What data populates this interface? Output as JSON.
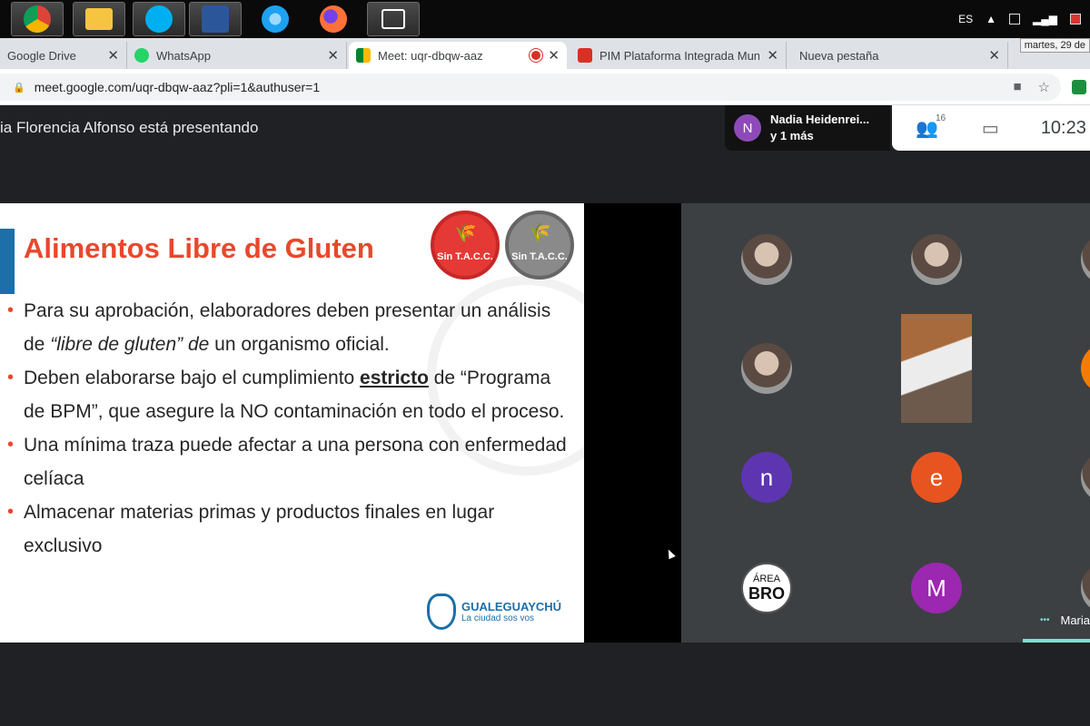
{
  "taskbar": {
    "apps": [
      {
        "name": "chrome",
        "color": "#db4437"
      },
      {
        "name": "file-explorer",
        "color": "#f5c542"
      },
      {
        "name": "skype",
        "color": "#00aff0"
      },
      {
        "name": "word",
        "color": "#2b579a"
      },
      {
        "name": "internet-explorer",
        "color": "#1ea1f1"
      },
      {
        "name": "firefox",
        "color": "#ff7139"
      },
      {
        "name": "presentation-app",
        "color": "#3a3a3a"
      }
    ],
    "language": "ES",
    "date_tooltip": "martes, 29 de"
  },
  "tabs": [
    {
      "title": "Google Drive",
      "favicon_color": "#34a853"
    },
    {
      "title": "WhatsApp",
      "favicon_color": "#25d366"
    },
    {
      "title": "Meet: uqr-dbqw-aaz",
      "favicon_color": "#00832d",
      "active": true
    },
    {
      "title": "PIM Plataforma Integrada Munic",
      "favicon_color": "#d93025"
    },
    {
      "title": "Nueva pestaña",
      "favicon_color": "#dee1e6"
    }
  ],
  "address_bar": {
    "url": "meet.google.com/uqr-dbqw-aaz?pli=1&authuser=1"
  },
  "meet": {
    "presenting_label": "ia Florencia Alfonso está presentando",
    "speaker_initial": "N",
    "speaker_name": "Nadia Heidenrei...",
    "speaker_more": "y 1 más",
    "participants_count": "16",
    "clock": "10:23"
  },
  "slide": {
    "title": "Alimentos Libre de Gluten",
    "badge_text": "Sin T.A.C.C.",
    "bullet1_a": "Para su aprobación, elaboradores deben presentar un análisis de ",
    "bullet1_b": "“libre de gluten” de",
    "bullet1_c": " un organismo oficial.",
    "bullet2_a": "Deben elaborarse bajo el cumplimiento ",
    "bullet2_b": "estricto",
    "bullet2_c": " de “Programa de BPM”, que asegure la NO contaminación en todo el proceso.",
    "bullet3": "Una mínima traza puede afectar a una persona con enfermedad celíaca",
    "bullet4": "Almacenar materias primas y productos finales en lugar exclusivo",
    "logo_name": "GUALEGUAYCHÚ",
    "logo_tagline": "La ciudad sos vos"
  },
  "participants": {
    "initial_n": "n",
    "initial_e": "e",
    "initial_m": "M",
    "area_line1": "ÁREA",
    "area_line2": "BRO",
    "self_name": "Maria",
    "more_dots": "•••",
    "colors": {
      "n": "#5e35b1",
      "e": "#e8541f",
      "m": "#9c27b0",
      "orange": "#f57c00"
    }
  }
}
